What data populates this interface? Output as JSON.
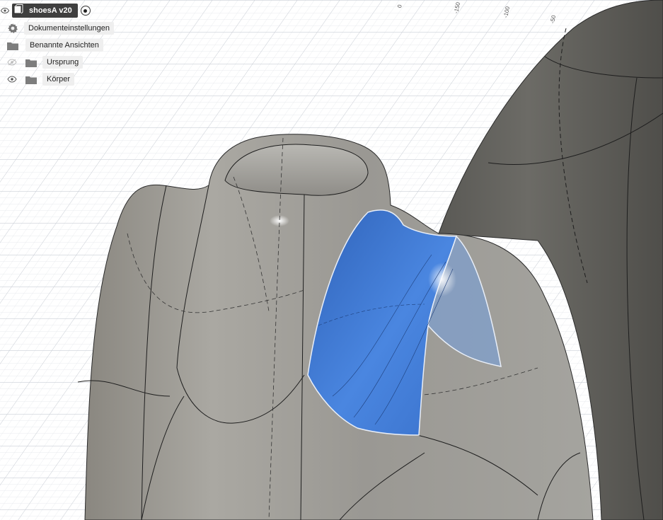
{
  "browser": {
    "root": {
      "name": "shoesA v20"
    },
    "items": [
      {
        "label": "Dokumenteinstellungen",
        "icon": "gear-icon"
      },
      {
        "label": "Benannte Ansichten",
        "icon": "folder-icon"
      },
      {
        "label": "Ursprung",
        "icon": "folder-icon",
        "visibility": "hidden"
      },
      {
        "label": "Körper",
        "icon": "folder-icon",
        "visibility": "visible"
      }
    ]
  },
  "grid_ticks": [
    "0",
    "-150",
    "-100",
    "-50"
  ],
  "colors": {
    "selection_face": "#3a78d8",
    "body_surface": "#8f8e89",
    "background": "#ffffff",
    "grid": "#d3d7de"
  }
}
